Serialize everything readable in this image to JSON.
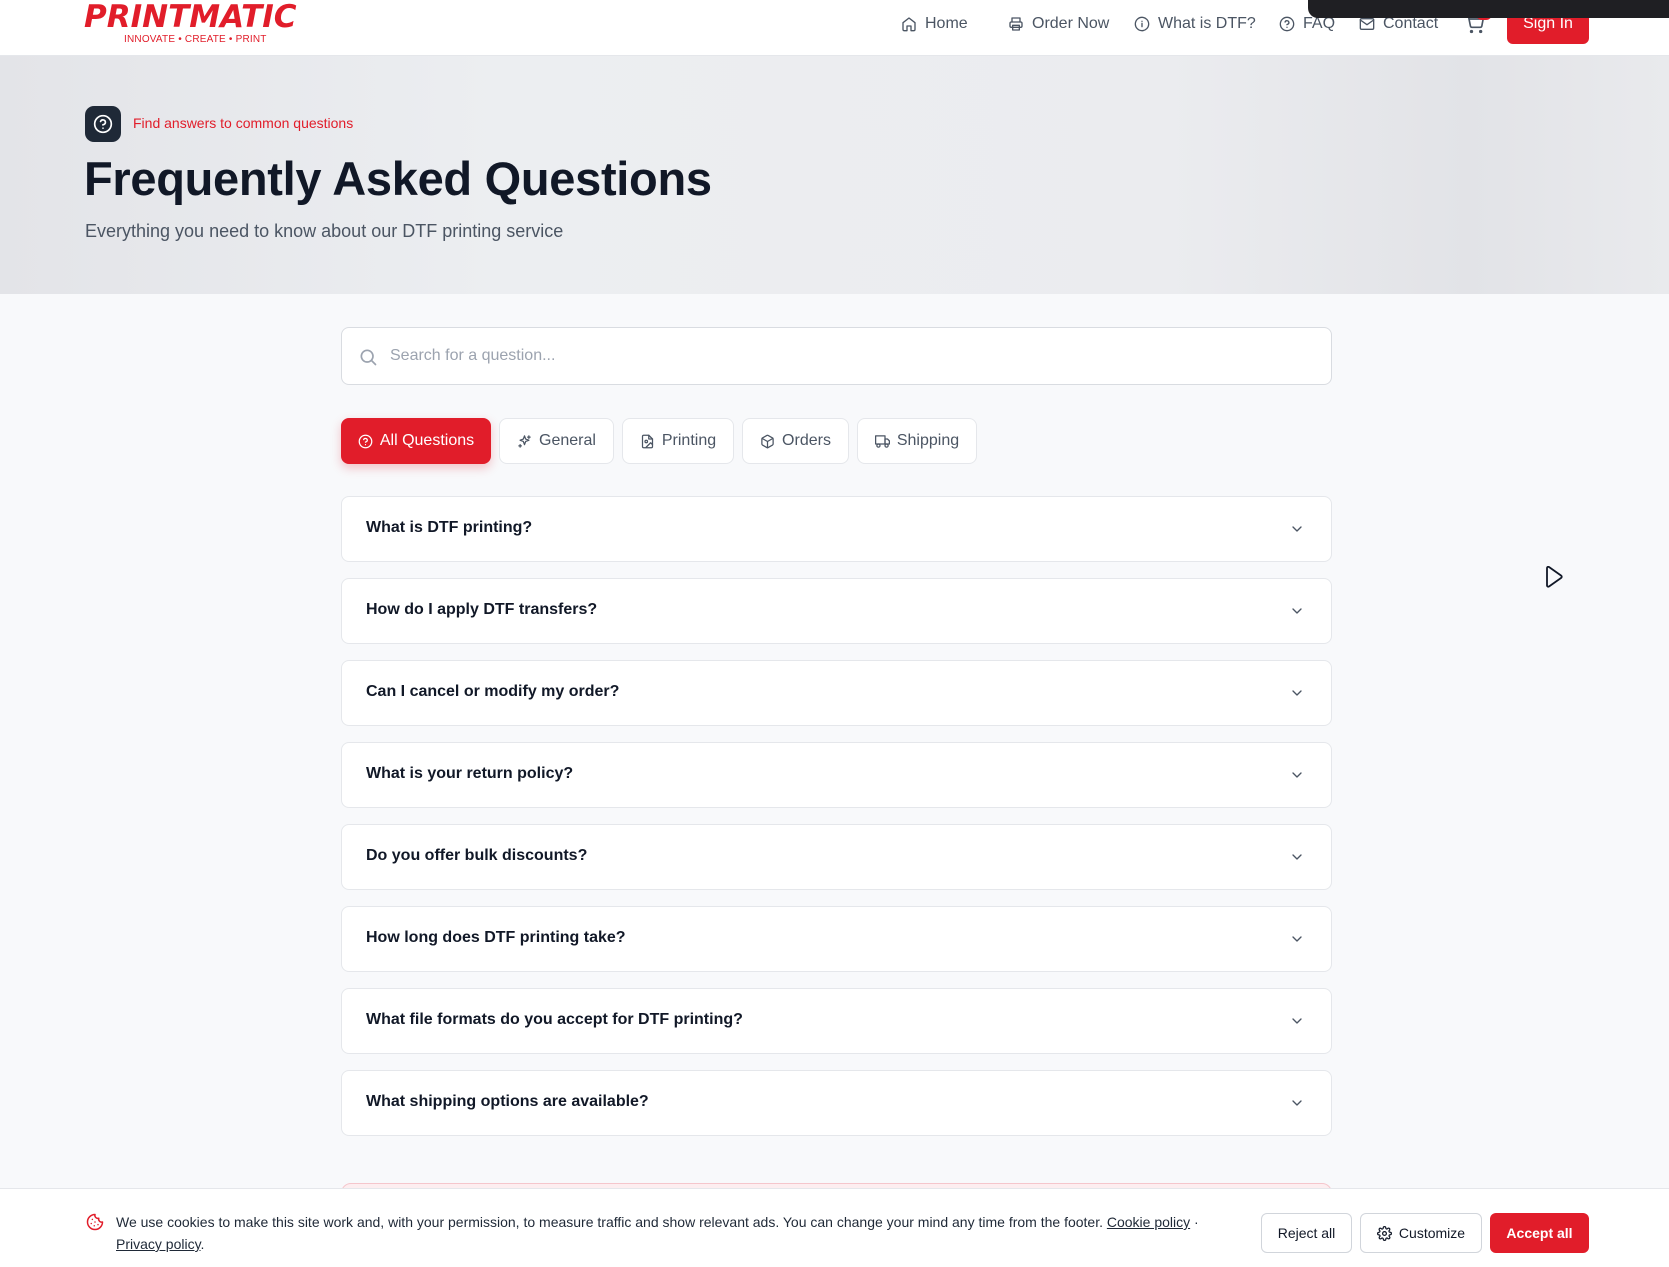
{
  "brand": {
    "name": "PRINTMATIC",
    "tagline": "INNOVATE • CREATE • PRINT",
    "accent_color": "#e11d2a"
  },
  "nav": {
    "items": [
      {
        "label": "Home",
        "icon": "home-icon"
      },
      {
        "label": "Order Now",
        "icon": "printer-icon"
      },
      {
        "label": "What is DTF?",
        "icon": "info-icon"
      },
      {
        "label": "FAQ",
        "icon": "help-circle-icon"
      },
      {
        "label": "Contact",
        "icon": "mail-icon"
      }
    ],
    "cart_icon": "cart-icon",
    "signin_label": "Sign In"
  },
  "hero": {
    "eyebrow": "Find answers to common questions",
    "title": "Frequently Asked Questions",
    "subtitle": "Everything you need to know about our DTF printing service"
  },
  "search": {
    "placeholder": "Search for a question...",
    "value": ""
  },
  "tabs": [
    {
      "label": "All Questions",
      "icon": "help-circle-icon",
      "active": true
    },
    {
      "label": "General",
      "icon": "sparkles-icon",
      "active": false
    },
    {
      "label": "Printing",
      "icon": "file-image-icon",
      "active": false
    },
    {
      "label": "Orders",
      "icon": "package-icon",
      "active": false
    },
    {
      "label": "Shipping",
      "icon": "truck-icon",
      "active": false
    }
  ],
  "faqs": [
    {
      "question": "What is DTF printing?"
    },
    {
      "question": "How do I apply DTF transfers?"
    },
    {
      "question": "Can I cancel or modify my order?"
    },
    {
      "question": "What is your return policy?"
    },
    {
      "question": "Do you offer bulk discounts?"
    },
    {
      "question": "How long does DTF printing take?"
    },
    {
      "question": "What file formats do you accept for DTF printing?"
    },
    {
      "question": "What shipping options are available?"
    }
  ],
  "cookie": {
    "text": "We use cookies to make this site work and, with your permission, to measure traffic and show relevant ads. You can change your mind any time from the footer.",
    "cookie_policy_label": "Cookie policy",
    "separator": "·",
    "privacy_policy_label": "Privacy policy",
    "end": ".",
    "reject_label": "Reject all",
    "customize_label": "Customize",
    "accept_label": "Accept all"
  }
}
